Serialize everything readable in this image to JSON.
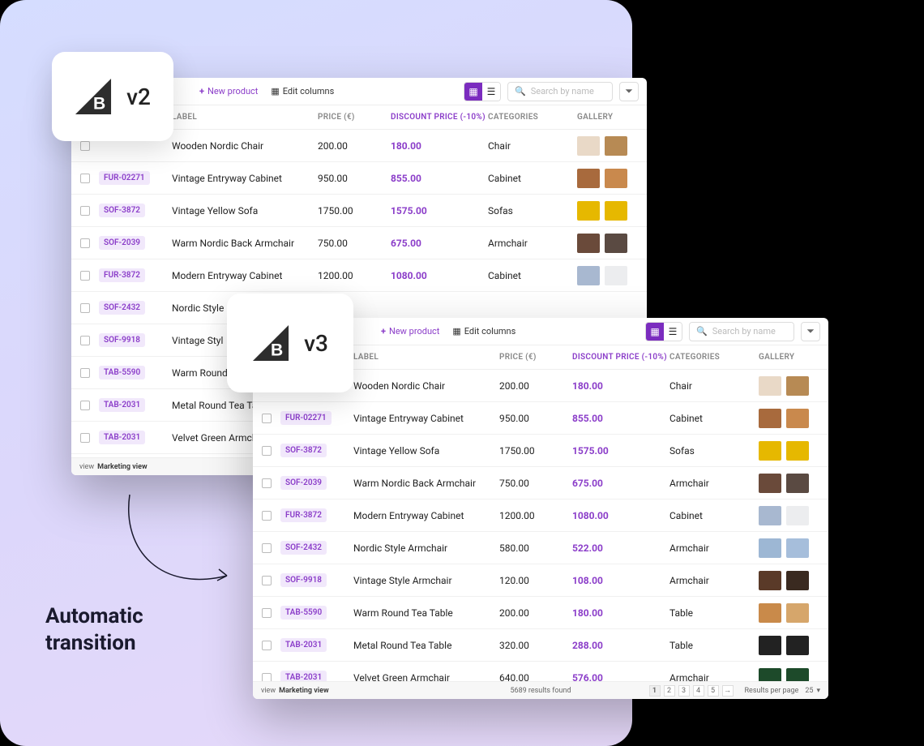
{
  "caption_line1": "Automatic",
  "caption_line2": "transition",
  "versions": {
    "v2": "v2",
    "v3": "v3"
  },
  "toolbar": {
    "new_product": "New product",
    "edit_columns": "Edit columns",
    "search_placeholder": "Search by name"
  },
  "headers": {
    "label": "LABEL",
    "price": "PRICE (€)",
    "discount": "DISCOUNT PRICE (-10%)",
    "categories": "CATEGORIES",
    "gallery": "GALLERY"
  },
  "footer": {
    "view_prefix": "view",
    "view_name": "Marketing view",
    "results": "5689 results found",
    "pages": [
      "1",
      "2",
      "3",
      "4",
      "5"
    ],
    "rpp_label": "Results per page",
    "rpp_value": "25"
  },
  "rows": [
    {
      "sku": "",
      "label": "Wooden Nordic Chair",
      "price": "200.00",
      "disc": "180.00",
      "cat": "Chair",
      "c1": "#e9d9c7",
      "c2": "#b78a54"
    },
    {
      "sku": "FUR-02271",
      "label": "Vintage Entryway Cabinet",
      "price": "950.00",
      "disc": "855.00",
      "cat": "Cabinet",
      "c1": "#a86a3d",
      "c2": "#c9894d"
    },
    {
      "sku": "SOF-3872",
      "label": "Vintage Yellow Sofa",
      "price": "1750.00",
      "disc": "1575.00",
      "cat": "Sofas",
      "c1": "#e6b800",
      "c2": "#e6b800"
    },
    {
      "sku": "SOF-2039",
      "label": "Warm Nordic Back Armchair",
      "price": "750.00",
      "disc": "675.00",
      "cat": "Armchair",
      "c1": "#6a4a3a",
      "c2": "#5a4a42"
    },
    {
      "sku": "FUR-3872",
      "label": "Modern Entryway Cabinet",
      "price": "1200.00",
      "disc": "1080.00",
      "cat": "Cabinet",
      "c1": "#a8b8d0",
      "c2": "#ecedef"
    },
    {
      "sku": "SOF-2432",
      "label": "Nordic Style Armchair",
      "price": "580.00",
      "disc": "522.00",
      "cat": "Armchair",
      "c1": "#9db7d4",
      "c2": "#a6bedb"
    },
    {
      "sku": "SOF-9918",
      "label": "Vintage Style Armchair",
      "price": "120.00",
      "disc": "108.00",
      "cat": "Armchair",
      "c1": "#5a3a28",
      "c2": "#3a2a20"
    },
    {
      "sku": "TAB-5590",
      "label": "Warm Round Tea Table",
      "price": "200.00",
      "disc": "180.00",
      "cat": "Table",
      "c1": "#c98a4a",
      "c2": "#d6a66b"
    },
    {
      "sku": "TAB-2031",
      "label": "Metal Round Tea Table",
      "price": "320.00",
      "disc": "288.00",
      "cat": "Table",
      "c1": "#222",
      "c2": "#222"
    },
    {
      "sku": "TAB-2031",
      "label": "Velvet Green Armchair",
      "price": "640.00",
      "disc": "576.00",
      "cat": "Armchair",
      "c1": "#1d4a2a",
      "c2": "#1d4a2a"
    }
  ],
  "rows_v2_trunc": [
    {
      "sku": "",
      "label": "Wooden Nordic Chair",
      "price": "200.00",
      "disc": "180.00",
      "cat": "Chair",
      "c1": "#e9d9c7",
      "c2": "#b78a54"
    },
    {
      "sku": "FUR-02271",
      "label": "Vintage Entryway Cabinet",
      "price": "950.00",
      "disc": "855.00",
      "cat": "Cabinet",
      "c1": "#a86a3d",
      "c2": "#c9894d"
    },
    {
      "sku": "SOF-3872",
      "label": "Vintage Yellow Sofa",
      "price": "1750.00",
      "disc": "1575.00",
      "cat": "Sofas",
      "c1": "#e6b800",
      "c2": "#e6b800"
    },
    {
      "sku": "SOF-2039",
      "label": "Warm Nordic Back Armchair",
      "price": "750.00",
      "disc": "675.00",
      "cat": "Armchair",
      "c1": "#6a4a3a",
      "c2": "#5a4a42"
    },
    {
      "sku": "FUR-3872",
      "label": "Modern Entryway Cabinet",
      "price": "1200.00",
      "disc": "1080.00",
      "cat": "Cabinet",
      "c1": "#a8b8d0",
      "c2": "#ecedef"
    },
    {
      "sku": "SOF-2432",
      "label": "Nordic Style",
      "price": "",
      "disc": "",
      "cat": "",
      "c1": "",
      "c2": ""
    },
    {
      "sku": "SOF-9918",
      "label": "Vintage Styl",
      "price": "",
      "disc": "",
      "cat": "",
      "c1": "",
      "c2": ""
    },
    {
      "sku": "TAB-5590",
      "label": "Warm Round",
      "price": "",
      "disc": "",
      "cat": "",
      "c1": "",
      "c2": ""
    },
    {
      "sku": "TAB-2031",
      "label": "Metal Round Tea Ta",
      "price": "",
      "disc": "",
      "cat": "",
      "c1": "",
      "c2": ""
    },
    {
      "sku": "TAB-2031",
      "label": "Velvet Green Armch",
      "price": "",
      "disc": "",
      "cat": "",
      "c1": "",
      "c2": ""
    }
  ]
}
